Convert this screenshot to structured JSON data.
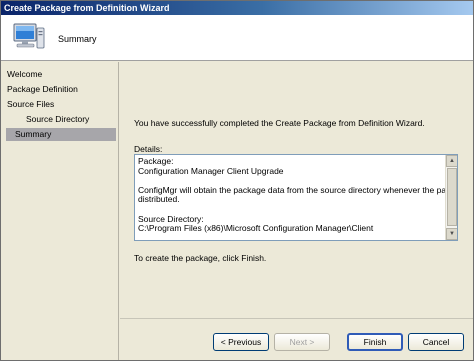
{
  "window": {
    "title": "Create Package from Definition Wizard"
  },
  "header": {
    "title": "Summary",
    "icon": "computer-icon"
  },
  "nav": {
    "items": [
      {
        "label": "Welcome",
        "indent": false,
        "active": false
      },
      {
        "label": "Package Definition",
        "indent": false,
        "active": false
      },
      {
        "label": "Source Files",
        "indent": false,
        "active": false
      },
      {
        "label": "Source Directory",
        "indent": true,
        "active": false
      },
      {
        "label": "Summary",
        "indent": false,
        "active": true
      }
    ]
  },
  "content": {
    "message": "You have successfully completed the Create Package from Definition Wizard.",
    "details_label": "Details:",
    "details": {
      "line1": "Package:",
      "line2": "Configuration Manager Client Upgrade",
      "line3": "ConfigMgr will obtain the package data from the source directory whenever the package is",
      "line4": "distributed.",
      "line5": "Source Directory:",
      "line6": "C:\\Program Files (x86)\\Microsoft Configuration Manager\\Client"
    },
    "finish_note": "To create the package, click Finish."
  },
  "footer": {
    "previous": "< Previous",
    "next": "Next >",
    "finish": "Finish",
    "cancel": "Cancel"
  }
}
